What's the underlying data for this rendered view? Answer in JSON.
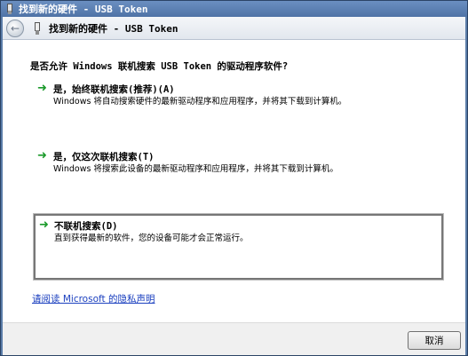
{
  "window": {
    "title": "找到新的硬件 - USB Token"
  },
  "nav": {
    "title": "找到新的硬件 - USB Token",
    "back_glyph": "←"
  },
  "main": {
    "question": "是否允许 Windows 联机搜索 USB Token 的驱动程序软件?",
    "options": [
      {
        "label": "是，始终联机搜索(推荐)(A)",
        "description": "Windows 将自动搜索硬件的最新驱动程序和应用程序，并将其下载到计算机。"
      },
      {
        "label": "是，仅这次联机搜索(T)",
        "description": "Windows 将搜索此设备的最新驱动程序和应用程序，并将其下载到计算机。"
      },
      {
        "label": "不联机搜索(D)",
        "description": "直到获得最新的软件，您的设备可能才会正常运行。"
      }
    ],
    "privacy_link": "请阅读 Microsoft 的隐私声明"
  },
  "footer": {
    "cancel_label": "取消"
  },
  "icons": {
    "option_arrow": "green-arrow-icon",
    "device": "usb-token-icon"
  },
  "colors": {
    "titlebar": "#5a7ca8",
    "link": "#1a3fbf",
    "arrow": "#1b9a2b"
  }
}
